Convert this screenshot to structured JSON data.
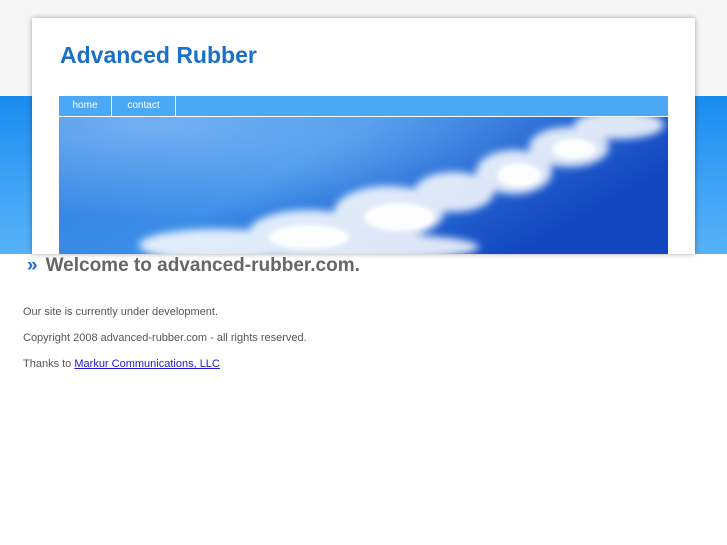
{
  "header": {
    "site_title": "Advanced Rubber"
  },
  "nav": {
    "items": [
      {
        "label": "home"
      },
      {
        "label": "contact"
      }
    ]
  },
  "banner": {
    "image": "sky-clouds-banner"
  },
  "content": {
    "welcome_marker": "»",
    "welcome_heading": "Welcome to advanced-rubber.com.",
    "development_notice": "Our site is currently under development.",
    "copyright": "Copyright 2008 advanced-rubber.com - all rights reserved.",
    "thanks_prefix": "Thanks to",
    "thanks_link": "Markur Communications, LLC"
  },
  "colors": {
    "title_blue": "#1a6fc9",
    "nav_blue": "#4aa8f5",
    "band_blue": "#3da2f5",
    "heading_gray": "#666666",
    "link_blue": "#1a1acc"
  }
}
